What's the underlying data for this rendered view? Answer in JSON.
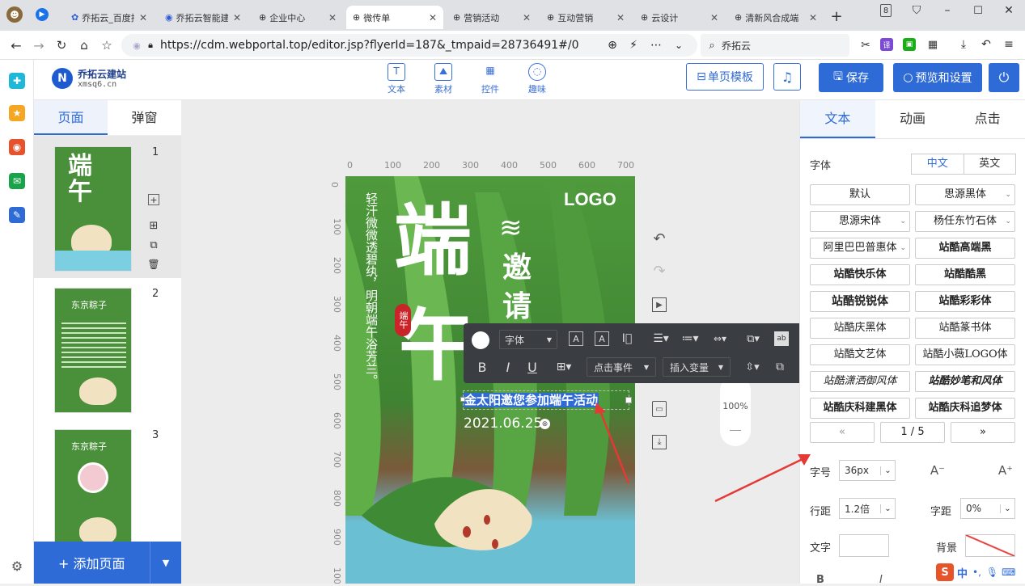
{
  "browser": {
    "tabs": [
      {
        "label": "乔拓云_百度拄"
      },
      {
        "label": "乔拓云智能建"
      },
      {
        "label": "企业中心"
      },
      {
        "label": "微传单"
      },
      {
        "label": "营销活动"
      },
      {
        "label": "互动营销"
      },
      {
        "label": "云设计"
      },
      {
        "label": "清新风合成端"
      }
    ],
    "tab_count_badge": "8",
    "url": "https://cdm.webportal.top/editor.jsp?flyerId=187&_tmpaid=28736491#/0",
    "search_text": "乔拓云"
  },
  "app": {
    "logo_name": "乔拓云建站",
    "logo_domain": "xmsq6.cn",
    "tools": [
      {
        "label": "文本"
      },
      {
        "label": "素材"
      },
      {
        "label": "控件"
      },
      {
        "label": "趣味"
      }
    ],
    "template_button": "单页模板",
    "save_button": "保存",
    "preview_button": "预览和设置"
  },
  "left_panel": {
    "tabs": [
      {
        "label": "页面"
      },
      {
        "label": "弹窗"
      }
    ],
    "page_numbers": [
      "1",
      "2",
      "3"
    ],
    "add_page": "+ 添加页面"
  },
  "canvas": {
    "ruler_h": [
      "0",
      "100",
      "200",
      "300",
      "400",
      "500",
      "600",
      "700"
    ],
    "ruler_v": [
      "0",
      "100",
      "200",
      "300",
      "400",
      "500",
      "600",
      "700",
      "800",
      "900",
      "100"
    ],
    "poster": {
      "logo": "LOGO",
      "big_char1": "端",
      "big_char2": "午",
      "invite": "邀请",
      "wave": "≋",
      "badge": "端午",
      "poem": "轻汗微微透碧纨，明朝端午浴芳兰。",
      "selected_text": "金太阳邀您参加端午活动",
      "date": "2021.06.25"
    },
    "zoom": "100%"
  },
  "text_toolbar": {
    "font_label": "字体",
    "click_event": "点击事件",
    "insert_var": "插入变量"
  },
  "right_panel": {
    "tabs": [
      {
        "label": "文本"
      },
      {
        "label": "动画"
      },
      {
        "label": "点击"
      }
    ],
    "font_section_label": "字体",
    "lang_toggle": [
      "中文",
      "英文"
    ],
    "fonts": [
      {
        "label": "默认"
      },
      {
        "label": "思源黑体"
      },
      {
        "label": "思源宋体"
      },
      {
        "label": "杨任东竹石体"
      },
      {
        "label": "阿里巴巴普惠体"
      },
      {
        "label": "站酷高端黑"
      },
      {
        "label": "站酷快乐体"
      },
      {
        "label": "站酷酷黑"
      },
      {
        "label": "站酷锐锐体"
      },
      {
        "label": "站酷彩彩体"
      },
      {
        "label": "站酷庆黑体"
      },
      {
        "label": "站酷篆书体"
      },
      {
        "label": "站酷文艺体"
      },
      {
        "label": "站酷小薇LOGO体"
      },
      {
        "label": "站酷潇洒御风体"
      },
      {
        "label": "站酷妙笔和风体"
      },
      {
        "label": "站酷庆科建黑体"
      },
      {
        "label": "站酷庆科追梦体"
      }
    ],
    "pagination": {
      "prev": "«",
      "page": "1 / 5",
      "next": "»"
    },
    "font_size_label": "字号",
    "font_size_value": "36px",
    "line_height_label": "行距",
    "line_height_value": "1.2倍",
    "letter_spacing_label": "字距",
    "letter_spacing_value": "0%",
    "text_color_label": "文字",
    "bg_label": "背景"
  },
  "ime": {
    "label": "中"
  }
}
